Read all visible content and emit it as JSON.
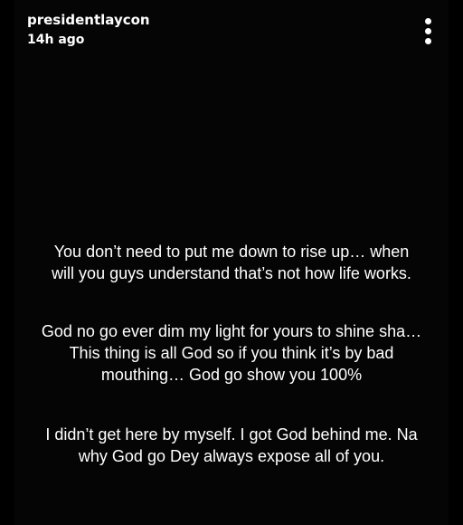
{
  "header": {
    "username": "presidentlaycon",
    "timestamp": "14h ago",
    "menu_icon": "more-vertical-icon"
  },
  "captions": [
    {
      "lines": [
        "You don’t need to put me down to rise up… when",
        "will you guys understand that’s not how life works."
      ]
    },
    {
      "lines": [
        "God no go ever dim my light for yours to shine sha…",
        "This thing is all God so if you think it’s by bad",
        "mouthing… God go show you 100%"
      ]
    },
    {
      "lines": [
        "I didn’t get here by myself. I got God behind me. Na",
        "why God go Dey always expose all of you."
      ]
    }
  ],
  "colors": {
    "background": "#000000",
    "text": "#ffffff"
  }
}
